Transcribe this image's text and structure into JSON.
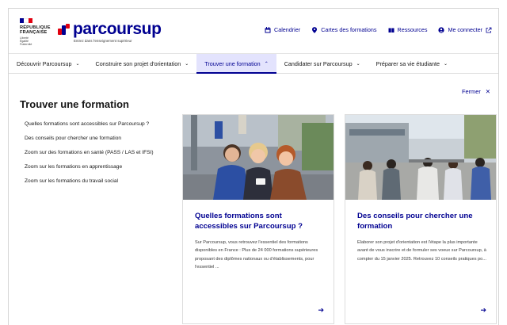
{
  "brand": {
    "gov_line1": "RÉPUBLIQUE",
    "gov_line2": "FRANÇAISE",
    "devise": [
      "Liberté",
      "Égalité",
      "Fraternité"
    ],
    "logo": "parcoursup",
    "tagline": "Entrez dans l'enseignement supérieur",
    "primary_color": "#000091",
    "flag_colors": [
      "#000091",
      "#ffffff",
      "#e1000f"
    ]
  },
  "toplinks": [
    {
      "icon": "calendar-icon",
      "label": "Calendrier"
    },
    {
      "icon": "map-pin-icon",
      "label": "Cartes des formations"
    },
    {
      "icon": "book-icon",
      "label": "Ressources"
    },
    {
      "icon": "user-icon",
      "label": "Me connecter"
    }
  ],
  "nav": {
    "items": [
      {
        "label": "Découvrir Parcoursup",
        "active": false
      },
      {
        "label": "Construire son projet d'orientation",
        "active": false
      },
      {
        "label": "Trouver une formation",
        "active": true
      },
      {
        "label": "Candidater sur Parcoursup",
        "active": false
      },
      {
        "label": "Préparer sa vie étudiante",
        "active": false
      }
    ]
  },
  "panel": {
    "close_label": "Fermer",
    "title": "Trouver une formation",
    "links": [
      "Quelles formations sont accessibles sur Parcoursup ?",
      "Des conseils pour chercher une formation",
      "Zoom sur des formations en santé (PASS / LAS et IFSI)",
      "Zoom sur les formations en apprentissage",
      "Zoom sur les formations du travail social"
    ]
  },
  "cards": [
    {
      "title": "Quelles formations sont accessibles sur Parcoursup ?",
      "description": "Sur Parcoursup, vous retrouvez l'essentiel des formations disponibles en France : Plus de 24 000 formations supérieures proposant des diplômes nationaux ou d'établissements, pour l'essentiel ...",
      "image": "students-looking-at-phone-photo"
    },
    {
      "title": "Des conseils pour chercher une formation",
      "description": "Elaborer son projet d'orientation est l'étape la plus importante avant de vous inscrire et de formuler ses voeux sur Parcoursup, à compter du 15 janvier 2025. Retrouvez 10 conseils pratiques po...",
      "image": "students-sitting-on-campus-photo"
    }
  ]
}
